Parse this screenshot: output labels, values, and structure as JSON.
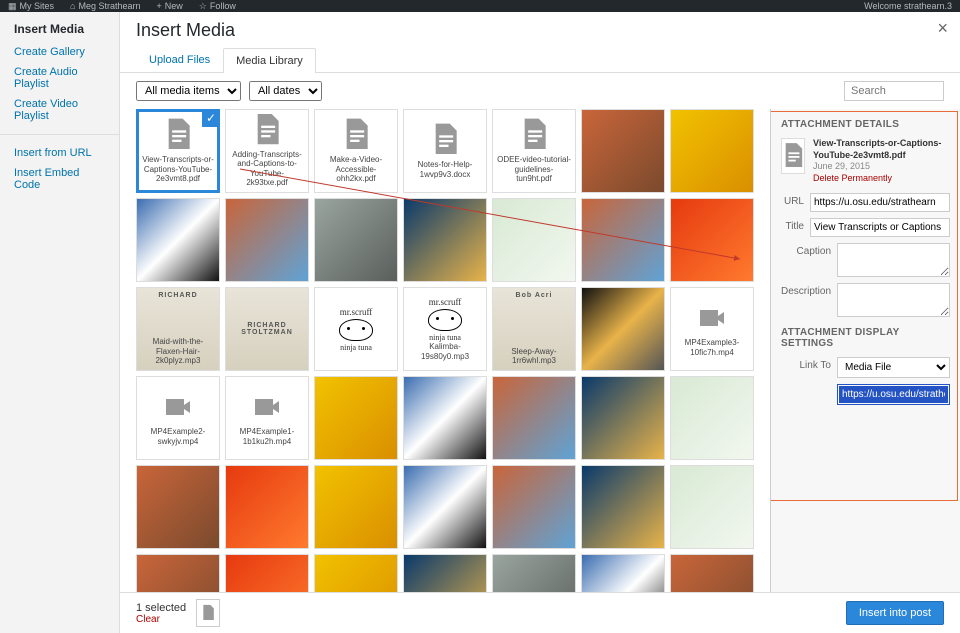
{
  "adminbar": {
    "mysites": "My Sites",
    "username": "Meg Strathearn",
    "new": "New",
    "follow": "Follow",
    "welcome": "Welcome strathearn.3"
  },
  "menu": {
    "title": "Insert Media",
    "items": [
      "Create Gallery",
      "Create Audio Playlist",
      "Create Video Playlist"
    ],
    "items2": [
      "Insert from URL",
      "Insert Embed Code"
    ]
  },
  "header": {
    "title": "Insert Media"
  },
  "tabs": {
    "upload": "Upload Files",
    "library": "Media Library"
  },
  "filters": {
    "type_label": "All media items",
    "date_label": "All dates",
    "search_placeholder": "Search"
  },
  "tiles": [
    {
      "kind": "doc",
      "label": "View-Transcripts-or-Captions-YouTube-2e3vmt8.pdf",
      "selected": true
    },
    {
      "kind": "doc",
      "label": "Adding-Transcripts-and-Captions-to-YouTube-2k93txe.pdf"
    },
    {
      "kind": "doc",
      "label": "Make-a-Video-Accessible-ohh2kx.pdf"
    },
    {
      "kind": "doc",
      "label": "Notes-for-Help-1wvp9v3.docx"
    },
    {
      "kind": "doc",
      "label": "ODEE-video-tutorial-guidelines-tun9ht.pdf"
    },
    {
      "kind": "img",
      "colors": [
        "#c9653a",
        "#7a4a2d"
      ]
    },
    {
      "kind": "img",
      "colors": [
        "#f2c200",
        "#d98f00"
      ]
    },
    {
      "kind": "img",
      "colors": [
        "#3a6db0",
        "#ffffff",
        "#111"
      ]
    },
    {
      "kind": "img",
      "colors": [
        "#c9653a",
        "#5fa3d6"
      ]
    },
    {
      "kind": "img",
      "colors": [
        "#9aa5a0",
        "#5a5f5c"
      ]
    },
    {
      "kind": "img",
      "colors": [
        "#0a3a6b",
        "#e8b34a"
      ]
    },
    {
      "kind": "img",
      "colors": [
        "#d8e9d4",
        "#f2f7ef"
      ]
    },
    {
      "kind": "img",
      "colors": [
        "#c9653a",
        "#5fa3d6"
      ]
    },
    {
      "kind": "img",
      "colors": [
        "#e63a0f",
        "#ff7a2e"
      ]
    },
    {
      "kind": "docimg",
      "label": "Maid-with-the-Flaxen-Hair-2k0plyz.mp3",
      "top": "RICHARD"
    },
    {
      "kind": "docimg",
      "label": "",
      "top": "RICHARD STOLTZMAN"
    },
    {
      "kind": "scruff",
      "label": ""
    },
    {
      "kind": "scruff",
      "label": "Kalimba-19s80y0.mp3"
    },
    {
      "kind": "docimg",
      "label": "Sleep-Away-1rr6whl.mp3",
      "top": "Bob Acri"
    },
    {
      "kind": "img",
      "colors": [
        "#111",
        "#e8b34a",
        "#555"
      ]
    },
    {
      "kind": "video",
      "label": "MP4Example3-10fic7h.mp4"
    },
    {
      "kind": "video",
      "label": "MP4Example2-swkyjv.mp4"
    },
    {
      "kind": "video",
      "label": "MP4Example1-1b1ku2h.mp4"
    },
    {
      "kind": "img",
      "colors": [
        "#f2c200",
        "#d98f00"
      ]
    },
    {
      "kind": "img",
      "colors": [
        "#3a6db0",
        "#ffffff",
        "#111"
      ]
    },
    {
      "kind": "img",
      "colors": [
        "#c9653a",
        "#5fa3d6"
      ]
    },
    {
      "kind": "img",
      "colors": [
        "#0a3a6b",
        "#e8b34a"
      ]
    },
    {
      "kind": "img",
      "colors": [
        "#d8e9d4",
        "#f2f7ef"
      ]
    },
    {
      "kind": "img",
      "colors": [
        "#c9653a",
        "#7a4a2d"
      ]
    },
    {
      "kind": "img",
      "colors": [
        "#e63a0f",
        "#ff7a2e"
      ]
    },
    {
      "kind": "img",
      "colors": [
        "#f2c200",
        "#d98f00"
      ]
    },
    {
      "kind": "img",
      "colors": [
        "#3a6db0",
        "#ffffff",
        "#111"
      ]
    },
    {
      "kind": "img",
      "colors": [
        "#c9653a",
        "#5fa3d6"
      ]
    },
    {
      "kind": "img",
      "colors": [
        "#0a3a6b",
        "#e8b34a"
      ]
    },
    {
      "kind": "img",
      "colors": [
        "#d8e9d4",
        "#f2f7ef"
      ]
    },
    {
      "kind": "img",
      "colors": [
        "#c9653a",
        "#7a4a2d"
      ]
    },
    {
      "kind": "img",
      "colors": [
        "#e63a0f",
        "#ff7a2e"
      ]
    },
    {
      "kind": "img",
      "colors": [
        "#f2c200",
        "#d98f00"
      ]
    },
    {
      "kind": "img",
      "colors": [
        "#0a3a6b",
        "#e8b34a"
      ]
    },
    {
      "kind": "img",
      "colors": [
        "#9aa5a0",
        "#5a5f5c"
      ]
    },
    {
      "kind": "img",
      "colors": [
        "#3a6db0",
        "#ffffff",
        "#111"
      ]
    },
    {
      "kind": "img",
      "colors": [
        "#c9653a",
        "#7a4a2d"
      ]
    }
  ],
  "details": {
    "heading": "ATTACHMENT DETAILS",
    "filename": "View-Transcripts-or-Captions-YouTube-2e3vmt8.pdf",
    "date": "June 29, 2015",
    "delete": "Delete Permanently",
    "url_label": "URL",
    "url_value": "https://u.osu.edu/strathearn",
    "title_label": "Title",
    "title_value": "View Transcripts or Captions",
    "caption_label": "Caption",
    "caption_value": "",
    "desc_label": "Description",
    "desc_value": "",
    "display_heading": "ATTACHMENT DISPLAY SETTINGS",
    "linkto_label": "Link To",
    "linkto_value": "Media File",
    "linkto_url": "https://u.osu.edu/strathearn"
  },
  "footer": {
    "selected": "1 selected",
    "clear": "Clear",
    "insert": "Insert into post"
  }
}
